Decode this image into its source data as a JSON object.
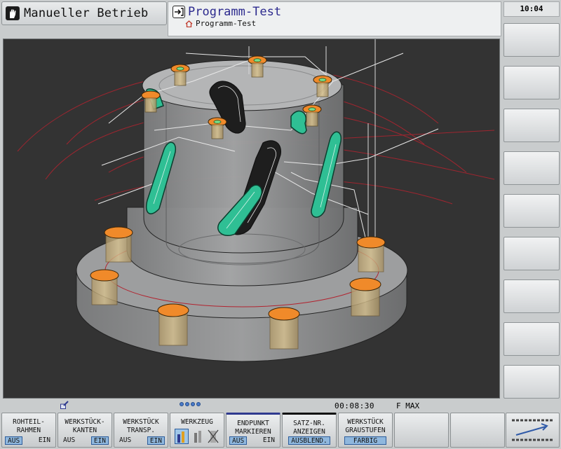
{
  "header": {
    "machine_mode": "Manueller Betrieb",
    "program_mode": "Programm-Test",
    "program_name": "Programm-Test",
    "clock": "10:04"
  },
  "status": {
    "run_time": "00:08:30",
    "feed": "F MAX"
  },
  "softkeys": [
    {
      "line1": "ROHTEIL-",
      "line2": "RAHMEN",
      "switch": [
        "AUS",
        "EIN"
      ],
      "selected": "AUS"
    },
    {
      "line1": "WERKSTÜCK-",
      "line2": "KANTEN",
      "switch": [
        "AUS",
        "EIN"
      ],
      "selected": "EIN"
    },
    {
      "line1": "WERKSTÜCK",
      "line2": "TRANSP.",
      "switch": [
        "AUS",
        "EIN"
      ],
      "selected": "EIN"
    },
    {
      "line1": "WERKZEUG",
      "line2": ""
    },
    {
      "line1": "ENDPUNKT",
      "line2": "MARKIEREN",
      "switch": [
        "AUS",
        "EIN"
      ],
      "selected": "AUS"
    },
    {
      "line1": "SATZ-NR.",
      "line2": "ANZEIGEN",
      "value": "AUSBLEND."
    },
    {
      "line1": "WERKSTÜCK",
      "line2": "GRAUSTUFEN",
      "value": "FARBIG"
    }
  ],
  "icons": {
    "machine_mode": "manual-hand-icon",
    "program_mode": "program-run-icon",
    "program_name": "home-icon",
    "status_edit": "edit-pencil-icon",
    "next_softkey_row": "arrow-next-icon"
  },
  "colors": {
    "viewport_background": "#333333",
    "workpiece": "#8f9091",
    "pocket_green": "#2fbf94",
    "bore_orange": "#f08a2a",
    "title_blue": "#2c2a8e"
  }
}
